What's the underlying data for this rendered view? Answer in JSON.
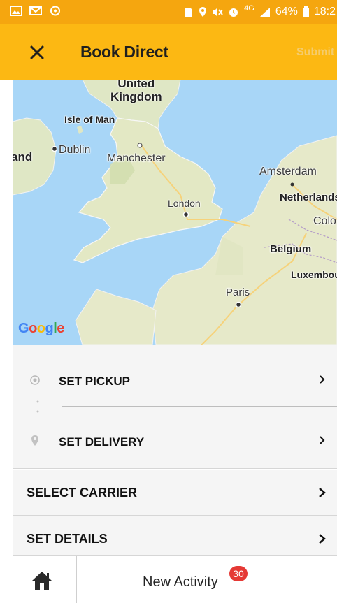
{
  "status_bar": {
    "network": "4G",
    "battery": "64%",
    "time": "18:2",
    "left_icons": [
      "image-icon",
      "mail-icon",
      "sync-icon"
    ],
    "right_icons": [
      "sim-icon",
      "location-icon",
      "mute-icon",
      "alarm-icon",
      "signal-icon",
      "battery-icon"
    ]
  },
  "toolbar": {
    "title": "Book Direct",
    "submit_label": "Submit",
    "background": "#fcb813"
  },
  "map": {
    "labels": {
      "united_kingdom": "United\nKingdom",
      "isle_of_man": "Isle of Man",
      "ireland": "and",
      "dublin": "Dublin",
      "manchester": "Manchester",
      "london": "London",
      "amsterdam": "Amsterdam",
      "netherlands": "Netherlands",
      "cologne": "Colo",
      "belgium": "Belgium",
      "luxembourg": "Luxembou",
      "paris": "Paris"
    },
    "attribution": [
      "G",
      "o",
      "o",
      "g",
      "l",
      "e"
    ]
  },
  "route": {
    "pickup_label": "SET PICKUP",
    "delivery_label": "SET DELIVERY"
  },
  "options": {
    "carrier_label": "SELECT CARRIER",
    "details_label": "SET DETAILS"
  },
  "bottom_nav": {
    "activity_label": "New Activity",
    "activity_count": "30"
  },
  "colors": {
    "status_bar": "#f5a60f",
    "accent": "#fcb813",
    "badge": "#e53935"
  }
}
